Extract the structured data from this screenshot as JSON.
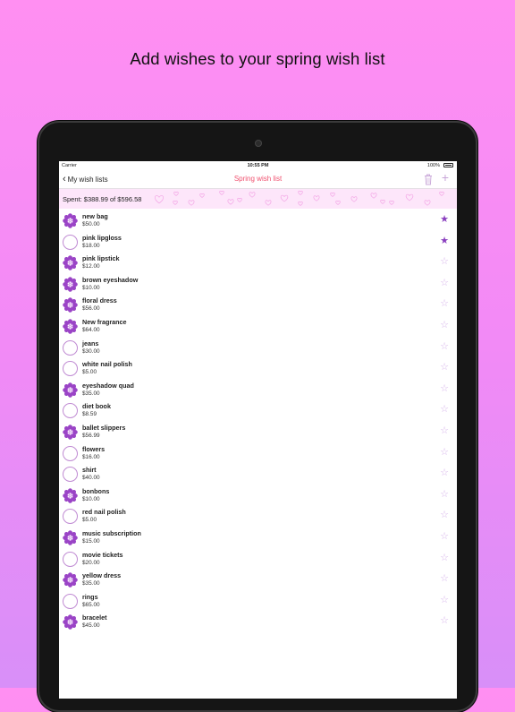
{
  "headline": "Add wishes to your spring wish list",
  "status_bar": {
    "carrier": "Carrier",
    "time": "10:55 PM",
    "battery": "100%"
  },
  "navbar": {
    "back_label": "My wish lists",
    "title": "Spring wish list",
    "trash_icon": "trash-icon",
    "add_icon": "plus-icon"
  },
  "summary": {
    "spent_text": "Spent: $388.99 of $596.58"
  },
  "colors": {
    "accent": "#f0506e",
    "purple": "#8a3fbf",
    "summary_bg": "#fde6fa"
  },
  "items": [
    {
      "name": "new bag",
      "price": "$50.00",
      "purchased": true,
      "starred": true
    },
    {
      "name": "pink lipgloss",
      "price": "$18.00",
      "purchased": false,
      "starred": true
    },
    {
      "name": "pink lipstick",
      "price": "$12.00",
      "purchased": true,
      "starred": false
    },
    {
      "name": "brown eyeshadow",
      "price": "$10.00",
      "purchased": true,
      "starred": false
    },
    {
      "name": "floral dress",
      "price": "$56.00",
      "purchased": true,
      "starred": false
    },
    {
      "name": "New fragrance",
      "price": "$64.00",
      "purchased": true,
      "starred": false
    },
    {
      "name": "jeans",
      "price": "$30.00",
      "purchased": false,
      "starred": false
    },
    {
      "name": "white nail polish",
      "price": "$5.00",
      "purchased": false,
      "starred": false
    },
    {
      "name": "eyeshadow quad",
      "price": "$35.00",
      "purchased": true,
      "starred": false
    },
    {
      "name": "diet book",
      "price": "$8.59",
      "purchased": false,
      "starred": false
    },
    {
      "name": "ballet slippers",
      "price": "$56.99",
      "purchased": true,
      "starred": false
    },
    {
      "name": "flowers",
      "price": "$16.00",
      "purchased": false,
      "starred": false
    },
    {
      "name": "shirt",
      "price": "$40.00",
      "purchased": false,
      "starred": false
    },
    {
      "name": "bonbons",
      "price": "$10.00",
      "purchased": true,
      "starred": false
    },
    {
      "name": "red nail polish",
      "price": "$5.00",
      "purchased": false,
      "starred": false
    },
    {
      "name": "music subscription",
      "price": "$15.00",
      "purchased": true,
      "starred": false
    },
    {
      "name": "movie tickets",
      "price": "$20.00",
      "purchased": false,
      "starred": false
    },
    {
      "name": "yellow dress",
      "price": "$35.00",
      "purchased": true,
      "starred": false
    },
    {
      "name": "rings",
      "price": "$65.00",
      "purchased": false,
      "starred": false
    },
    {
      "name": "bracelet",
      "price": "$45.00",
      "purchased": true,
      "starred": false
    }
  ]
}
